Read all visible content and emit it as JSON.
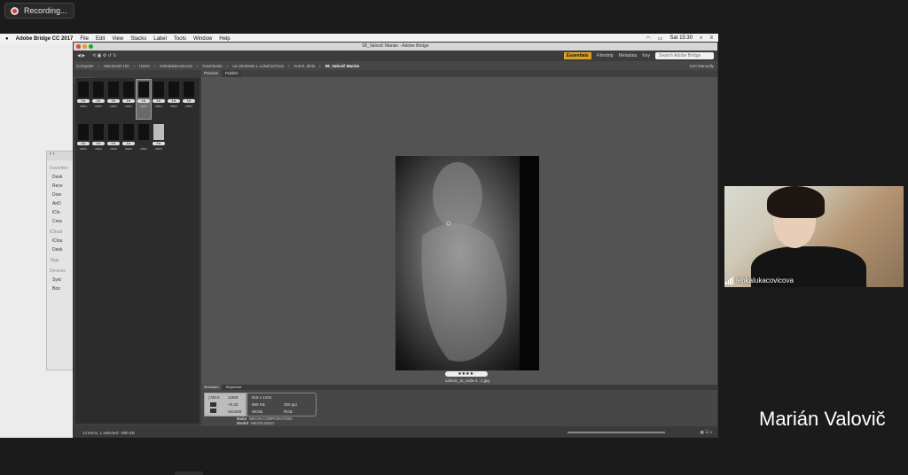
{
  "recording": {
    "label": "Recording..."
  },
  "menubar": {
    "app": "Adobe Bridge CC 2017",
    "items": [
      "File",
      "Edit",
      "View",
      "Stacks",
      "Label",
      "Tools",
      "Window",
      "Help"
    ],
    "clock": "Sat 15:30"
  },
  "finder": {
    "favorites_header": "Favorites",
    "favorites": [
      "Desk",
      "Rece",
      "Dow",
      "AirD",
      "iClo",
      "Crea"
    ],
    "icloud_header": "iCloud",
    "icloud": [
      "iClou",
      "Desk"
    ],
    "tags_header": "Tags",
    "devices_header": "Devices",
    "devices": [
      "Syst",
      "Boo"
    ]
  },
  "bridge": {
    "window_title": "08_Valovič Marián - Adobe Bridge",
    "workspaces": [
      "Essentials",
      "Filmstrip",
      "Metadata",
      "Key"
    ],
    "search_placeholder": "Search Adobe Bridge",
    "path": [
      "Computer",
      "Macintosh HD",
      "Users",
      "lenkalukacovicova",
      "Downloads",
      "na odoslanie L.Lukačovičová",
      "Autori, diela",
      "08_Valovič Marián"
    ],
    "sort_label": "Sort Manually",
    "content_tab": "Content",
    "preview_tabs": [
      "Preview",
      "Publish"
    ],
    "thumbnails": [
      {
        "stars": "4★",
        "name": "valov"
      },
      {
        "stars": "2★",
        "name": "valov"
      },
      {
        "stars": "3★",
        "name": "valov"
      },
      {
        "stars": "4★",
        "name": "valov"
      },
      {
        "stars": "4★",
        "name": "valov"
      },
      {
        "stars": "4★",
        "name": "valov"
      },
      {
        "stars": "4★",
        "name": "valov"
      },
      {
        "stars": "3★",
        "name": "valov"
      },
      {
        "stars": "4★",
        "name": "valov"
      },
      {
        "stars": "4★",
        "name": "valov"
      },
      {
        "stars": "5★",
        "name": "valov"
      },
      {
        "stars": "4★",
        "name": "valov"
      },
      {
        "stars": "",
        "name": "valov"
      },
      {
        "stars": "5★",
        "name": "valov"
      }
    ],
    "preview": {
      "rating": "★★★★·",
      "filename": "valovic_at_voda-4...1.jpg"
    },
    "metadata_tabs": [
      "Metadata",
      "Keywords"
    ],
    "metadata": {
      "aperture": "ƒ/20.0",
      "shutter": "1/250",
      "ev": "+0.33",
      "iso": "ISO400",
      "dimensions": "818 x 1234",
      "size": "890 KB",
      "ppi": "300 ppi",
      "color_space": "sRGB",
      "mode": "RGB",
      "make_label": "Make",
      "make": "NIKON CORPORATION",
      "model_label": "Model",
      "model": "NIKON D810"
    },
    "status": "14 items, 1 selected - 890 KB"
  },
  "participant": {
    "name": "lenkalukacovicova"
  },
  "speaker": {
    "name": "Marián Valovič"
  }
}
